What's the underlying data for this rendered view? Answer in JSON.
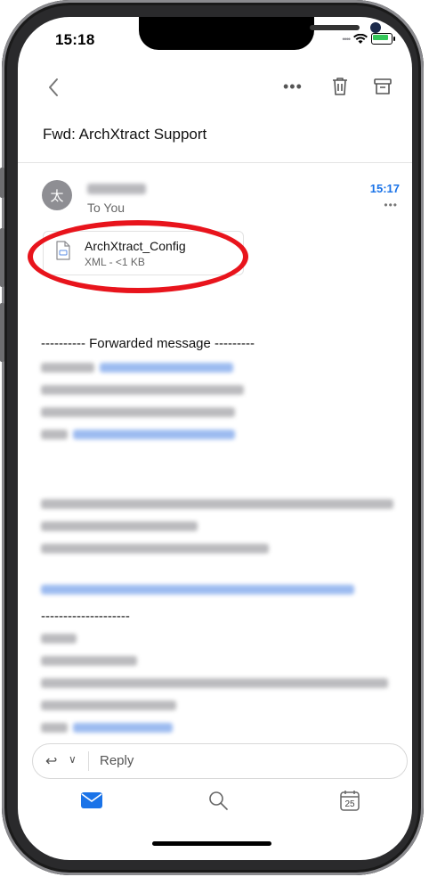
{
  "status_bar": {
    "time": "15:18"
  },
  "email": {
    "subject": "Fwd: ArchXtract Support",
    "avatar_char": "太",
    "to": "To You",
    "time": "15:17",
    "attachment": {
      "name": "ArchXtract_Config",
      "meta": "XML - <1 KB"
    },
    "forwarded_header": "---------- Forwarded message ---------",
    "separator": "--------------------"
  },
  "reply_bar": {
    "label": "Reply"
  },
  "tabbar": {
    "calendar_day": "25"
  },
  "colors": {
    "accent": "#1a73e8",
    "highlight": "#e8141c"
  }
}
